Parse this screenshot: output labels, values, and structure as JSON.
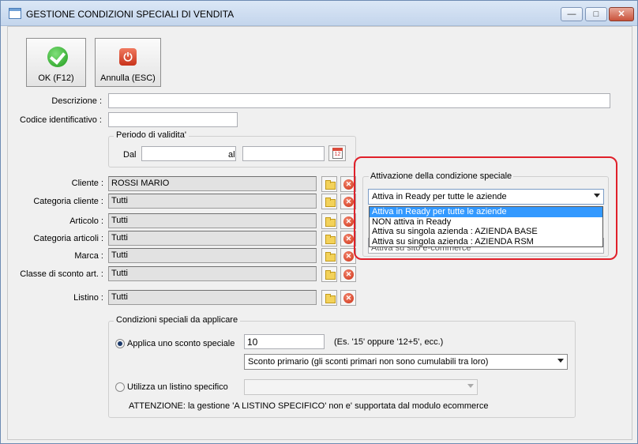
{
  "window": {
    "title": "GESTIONE CONDIZIONI SPECIALI DI VENDITA",
    "controls": {
      "minimize": "—",
      "maximize": "□",
      "close": "✕"
    }
  },
  "toolbar": {
    "ok_label": "OK (F12)",
    "cancel_label": "Annulla (ESC)"
  },
  "form": {
    "descrizione_label": "Descrizione :",
    "descrizione_value": "",
    "codice_label": "Codice identificativo :",
    "codice_value": "",
    "periodo": {
      "title": "Periodo di validita'",
      "dal_label": "Dal",
      "dal_value": "",
      "al_label": "al",
      "al_value": "",
      "calendar_text": "12"
    },
    "fields": [
      {
        "label": "Cliente :",
        "value": "ROSSI MARIO"
      },
      {
        "label": "Categoria cliente :",
        "value": "Tutti"
      },
      {
        "label": "Articolo :",
        "value": "Tutti"
      },
      {
        "label": "Categoria articoli :",
        "value": "Tutti"
      },
      {
        "label": "Marca :",
        "value": "Tutti"
      },
      {
        "label": "Classe di sconto art. :",
        "value": "Tutti"
      },
      {
        "label": "Listino :",
        "value": "Tutti"
      }
    ]
  },
  "attivazione": {
    "title": "Attivazione della condizione speciale",
    "selected": "Attiva in Ready per tutte le aziende",
    "options": [
      "Attiva in Ready per tutte le aziende",
      "NON attiva in Ready",
      "Attiva su singola azienda : AZIENDA BASE",
      "Attiva su singola azienda : AZIENDA RSM"
    ],
    "hidden_row_text": "Attiva su sito e-commerce"
  },
  "condizioni": {
    "title": "Condizioni speciali da applicare",
    "sconto_label": "Applica uno sconto speciale",
    "sconto_value": "10",
    "sconto_hint": "(Es. '15' oppure '12+5', ecc.)",
    "sconto_type": "Sconto primario (gli sconti primari non sono cumulabili tra loro)",
    "listino_label": "Utilizza un listino specifico",
    "listino_value": "",
    "warning": "ATTENZIONE: la gestione 'A LISTINO SPECIFICO' non e' supportata dal modulo ecommerce"
  }
}
